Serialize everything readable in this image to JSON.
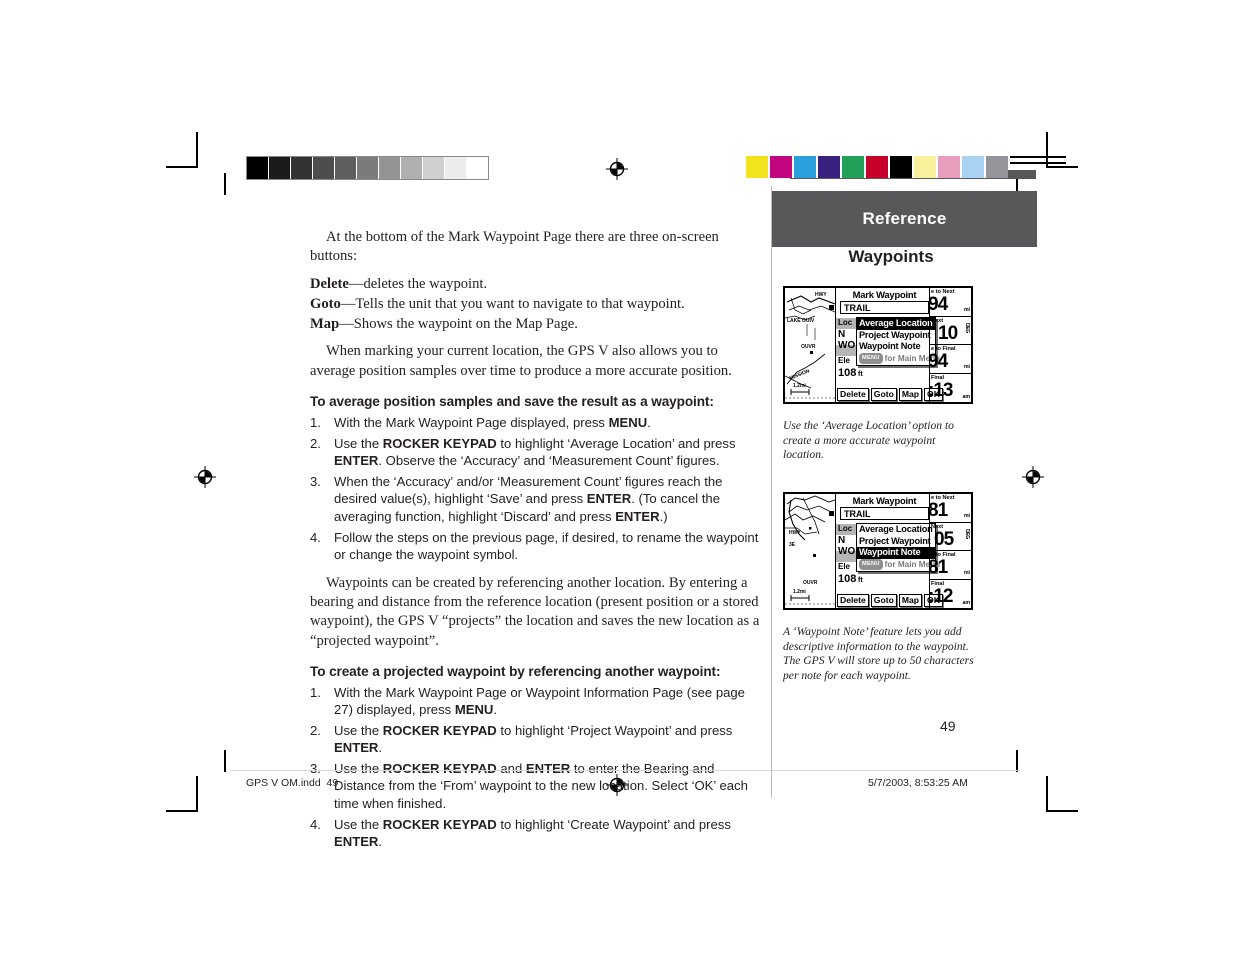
{
  "document": {
    "page_number": "49",
    "section_header": "Reference",
    "section_title": "Waypoints"
  },
  "body": {
    "intro": "At the bottom of the Mark Waypoint Page there are three on-screen buttons:",
    "definitions": [
      {
        "term": "Delete",
        "text": "—deletes the waypoint."
      },
      {
        "term": "Goto",
        "text": "—Tells the unit that you want to navigate to that waypoint."
      },
      {
        "term": "Map",
        "text": "—Shows the waypoint on the Map Page."
      }
    ],
    "paragraph_average": "When marking your current location, the GPS V also allows you to average position samples over time to produce a more accurate position.",
    "heading_average": "To average position samples and save the result as a waypoint:",
    "steps_average": [
      {
        "num": "1.",
        "html": "With the Mark Waypoint Page displayed, press <b>MENU</b>."
      },
      {
        "num": "2.",
        "html": "Use the <b>ROCKER KEYPAD</b> to highlight &lsquo;Average Location&rsquo; and press <b>ENTER</b>. Observe the &lsquo;Accuracy&rsquo; and &lsquo;Measurement Count&rsquo; figures."
      },
      {
        "num": "3.",
        "html": "When the &lsquo;Accuracy&rsquo; and/or &lsquo;Measurement Count&rsquo; figures reach the desired value(s), highlight &lsquo;Save&rsquo; and press <b>ENTER</b>. (To cancel the averaging function, highlight &lsquo;Discard&rsquo; and press <b>ENTER</b>.)"
      },
      {
        "num": "4.",
        "html": "Follow the steps on the previous page, if desired, to rename the waypoint or change the waypoint symbol."
      }
    ],
    "paragraph_project": "Waypoints can be created by referencing another location. By entering a bearing and distance from the reference location (present position or a stored waypoint), the GPS V &ldquo;projects&rdquo; the location and saves the new location as a &ldquo;projected waypoint&rdquo;.",
    "heading_project": "To create a projected waypoint by referencing another waypoint:",
    "steps_project": [
      {
        "num": "1.",
        "html": "With the Mark Waypoint Page or Waypoint Information Page (see page 27) displayed, press <b>MENU</b>."
      },
      {
        "num": "2.",
        "html": "Use the <b>ROCKER KEYPAD</b> to highlight &lsquo;Project Waypoint&rsquo; and press <b>ENTER</b>."
      },
      {
        "num": "3.",
        "html": "Use the <b>ROCKER KEYPAD</b> and <b>ENTER</b> to enter the Bearing and Distance from the &lsquo;From&rsquo; waypoint to the new location. Select &lsquo;OK&rsquo; each time when finished."
      },
      {
        "num": "4.",
        "html": "Use the <b>ROCKER KEYPAD</b> to highlight &lsquo;Create Waypoint&rsquo; and press <b>ENTER</b>."
      }
    ]
  },
  "figures": [
    {
      "caption": "Use the &lsquo;Average Location&rsquo; option to create a more accurate waypoint location.",
      "screen": {
        "title": "Mark Waypoint",
        "waypoint_name": "TRAIL",
        "labels": {
          "location": "Loc",
          "lat": "N",
          "lon": "WO",
          "elevation": "Ele"
        },
        "elevation_value": "108",
        "elevation_unit": "ft",
        "menu_items": [
          "Average Location",
          "Project Waypoint",
          "Waypoint Note"
        ],
        "menu_selected": "Average Location",
        "menu_hint_key": "MENU",
        "menu_hint_text": "for Main Menu",
        "buttons": [
          "Delete",
          "Goto",
          "Map",
          "OK"
        ],
        "map_labels": [
          "HWY",
          "LAKE OUIV",
          "OUVR",
          "MISSION"
        ],
        "map_scale": "1.2mi",
        "data_fields": [
          {
            "label": "e to Next",
            "value": "94",
            "unit": "mi"
          },
          {
            "label": "Next",
            "value": "10",
            "unit": "DEG"
          },
          {
            "label": "e to Final",
            "value": "94",
            "unit": "mi"
          },
          {
            "label": "Final",
            "value": ":13",
            "unit": "am"
          }
        ]
      }
    },
    {
      "caption": "A &lsquo;Waypoint Note&rsquo; feature lets you add descriptive information to the waypoint. The GPS V will store up to 50 characters per note for each waypoint.",
      "screen": {
        "title": "Mark Waypoint",
        "waypoint_name": "TRAIL",
        "labels": {
          "location": "Loc",
          "lat": "N",
          "lon": "WO",
          "elevation": "Ele"
        },
        "elevation_value": "108",
        "elevation_unit": "ft",
        "menu_items": [
          "Average Location",
          "Project Waypoint",
          "Waypoint Note"
        ],
        "menu_selected": "Waypoint Note",
        "menu_hint_key": "MENU",
        "menu_hint_text": "for Main Menu",
        "buttons": [
          "Delete",
          "Goto",
          "Map",
          "OK"
        ],
        "map_labels": [
          "HWY",
          "3E",
          "OUVR"
        ],
        "map_scale": "1.2mi",
        "data_fields": [
          {
            "label": "e to Next",
            "value": "81",
            "unit": "mi"
          },
          {
            "label": "Next",
            "value": "05",
            "unit": "DEG"
          },
          {
            "label": "e to Final",
            "value": "81",
            "unit": "mi"
          },
          {
            "label": "Final",
            "value": ":12",
            "unit": "am"
          }
        ]
      }
    }
  ],
  "print_marks": {
    "gray_wedge": [
      "#000000",
      "#1b1b1b",
      "#333333",
      "#4d4d4d",
      "#5e5e5e",
      "#7b7b7b",
      "#949494",
      "#b0b0b0",
      "#d0d0d0",
      "#ececec",
      "#ffffff"
    ],
    "color_patches": [
      "#f2e31c",
      "#c2067f",
      "#29a0dd",
      "#3a2180",
      "#23a05a",
      "#c60028",
      "#000000",
      "#f8f09a",
      "#e89ebc",
      "#a9d2f2",
      "#939598"
    ]
  },
  "footer": {
    "filename": "GPS V OM.indd",
    "file_page": "49",
    "timestamp": "5/7/2003, 8:53:25 AM"
  }
}
